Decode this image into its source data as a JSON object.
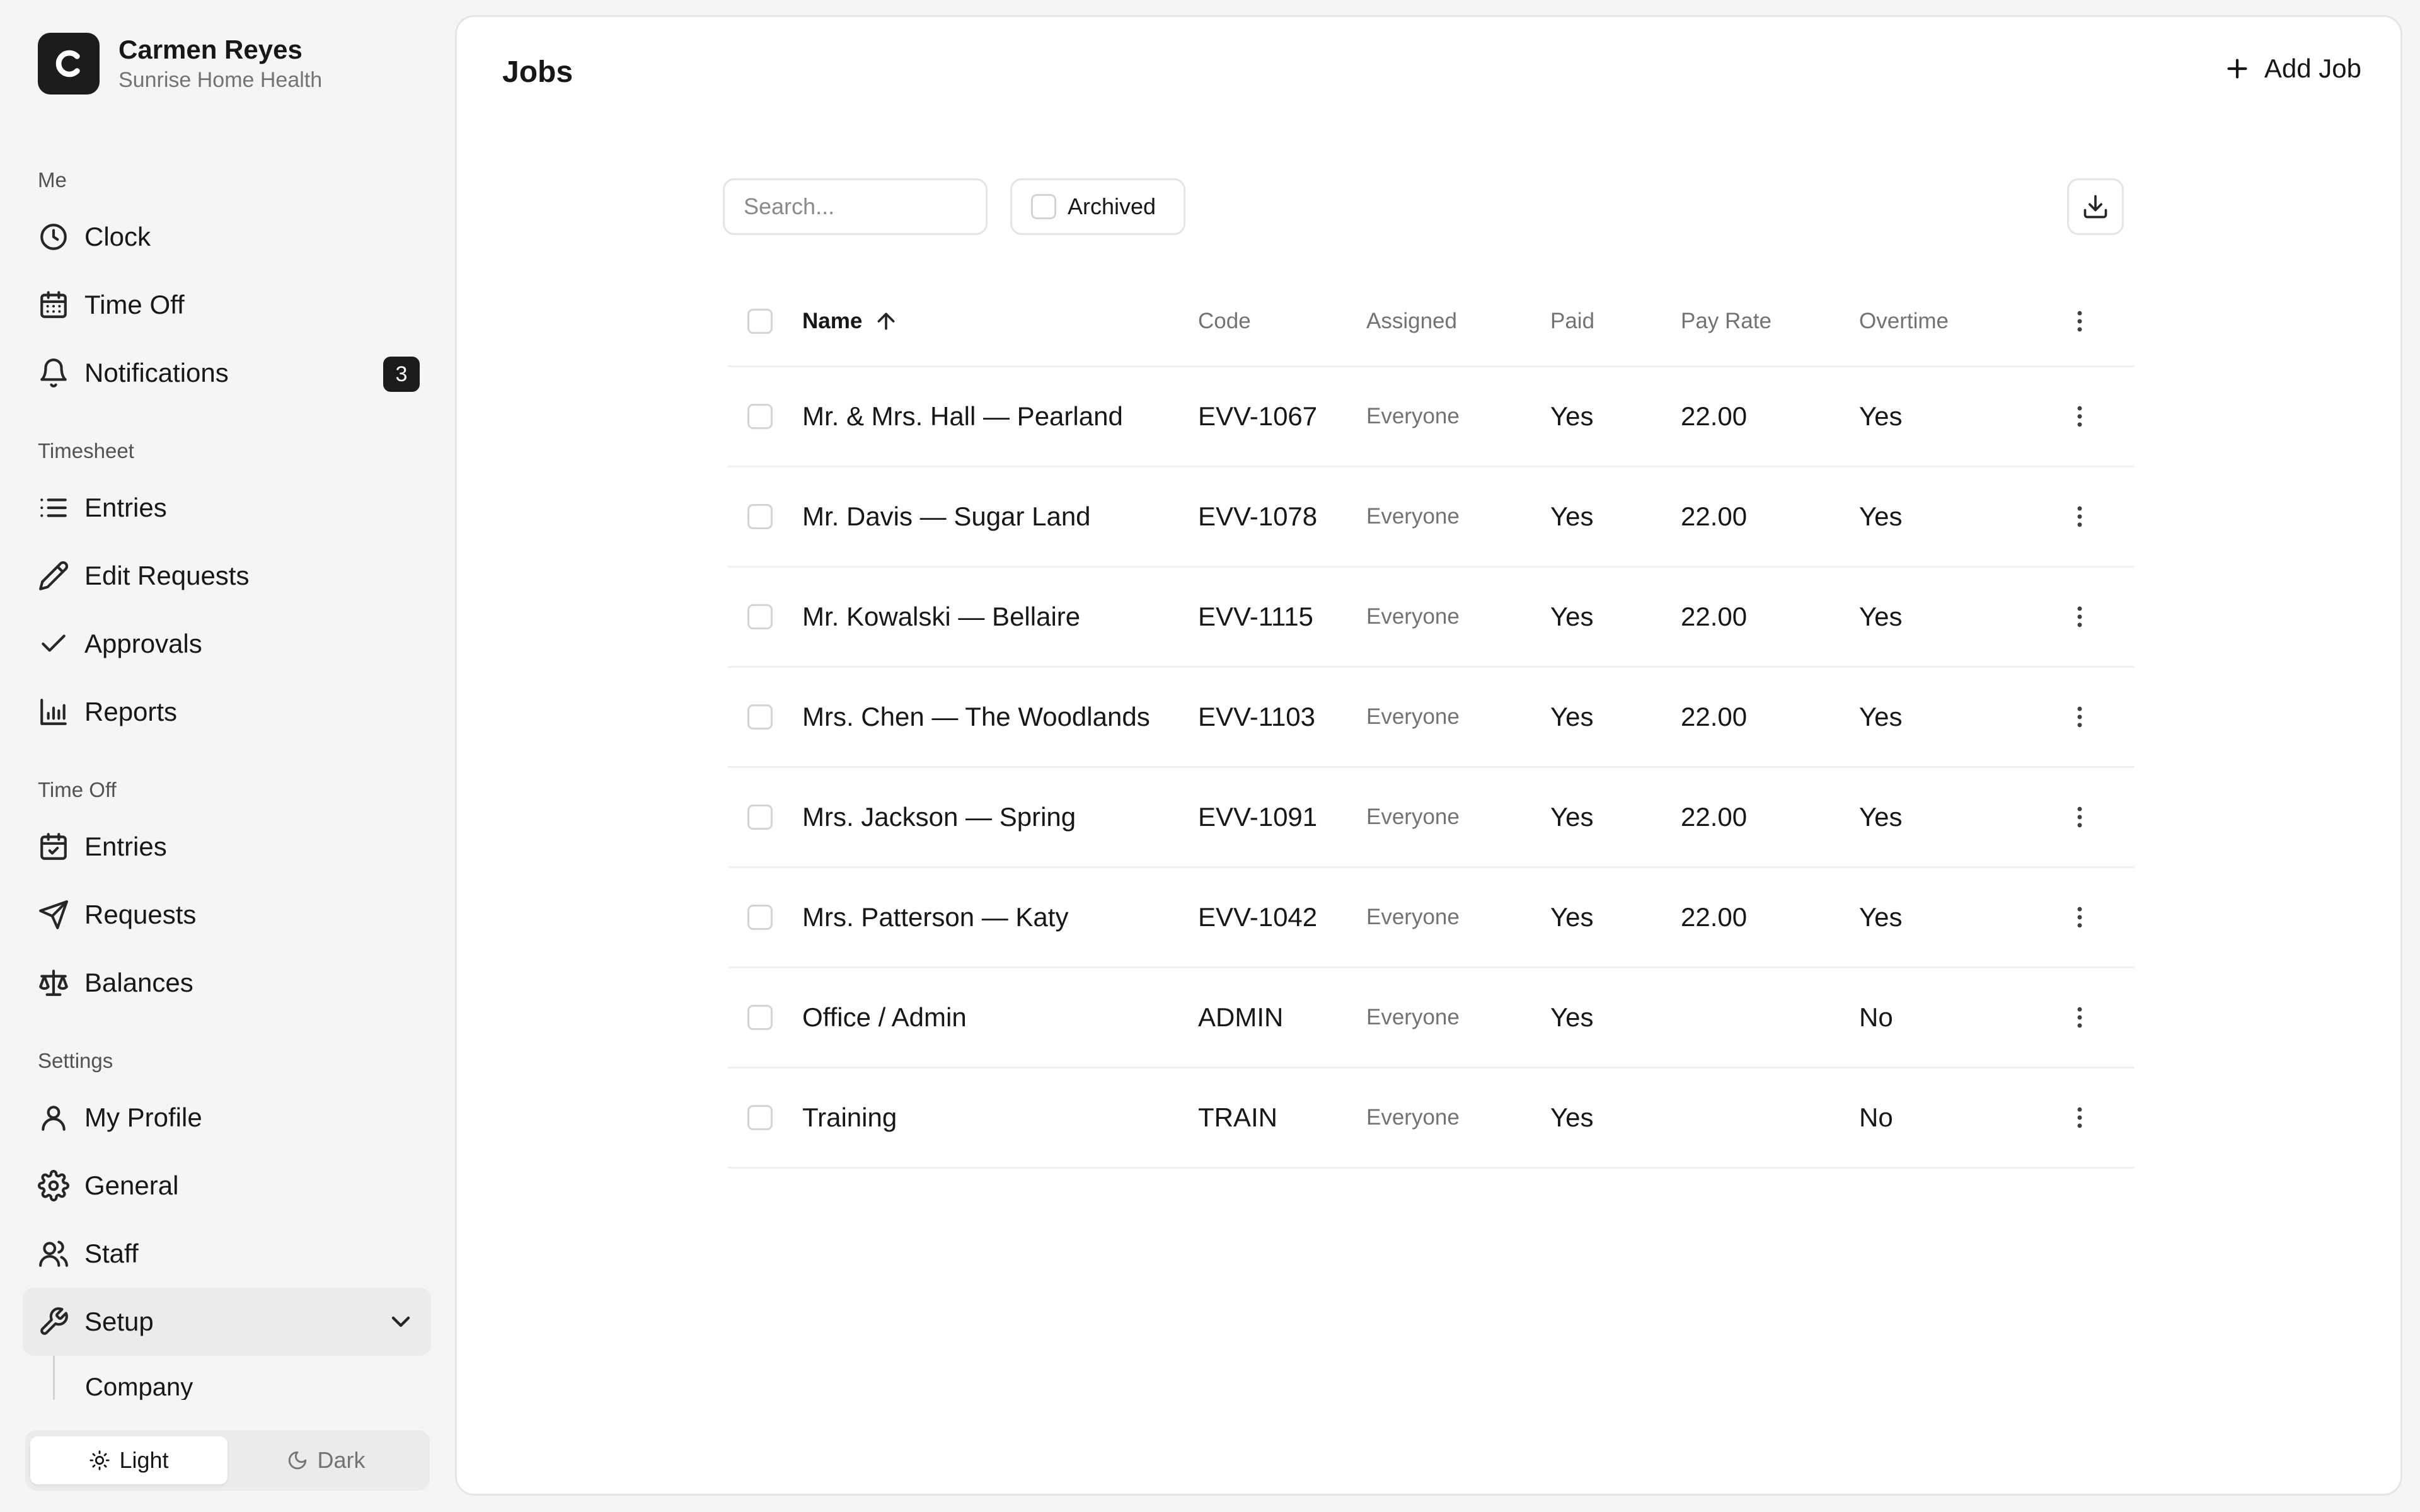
{
  "brand": {
    "initial": "C",
    "name": "Carmen Reyes",
    "org": "Sunrise Home Health"
  },
  "nav": {
    "me_label": "Me",
    "clock": "Clock",
    "time_off": "Time Off",
    "notifications": "Notifications",
    "notifications_count": "3",
    "timesheet_label": "Timesheet",
    "ts_entries": "Entries",
    "edit_requests": "Edit Requests",
    "approvals": "Approvals",
    "reports": "Reports",
    "timeoff_label": "Time Off",
    "to_entries": "Entries",
    "requests": "Requests",
    "balances": "Balances",
    "settings_label": "Settings",
    "my_profile": "My Profile",
    "general": "General",
    "staff": "Staff",
    "setup": "Setup",
    "company": "Company"
  },
  "theme": {
    "light": "Light",
    "dark": "Dark",
    "selected": "Light"
  },
  "header": {
    "title": "Jobs",
    "add_job": "Add Job"
  },
  "toolbar": {
    "search_placeholder": "Search...",
    "search_value": "",
    "archived_label": "Archived",
    "archived_checked": false
  },
  "table": {
    "columns": {
      "name": "Name",
      "code": "Code",
      "assigned": "Assigned",
      "paid": "Paid",
      "pay_rate": "Pay Rate",
      "overtime": "Overtime"
    },
    "sort": {
      "column": "name",
      "direction": "asc"
    },
    "rows": [
      {
        "name": "Mr. & Mrs. Hall — Pearland",
        "code": "EVV-1067",
        "assigned": "Everyone",
        "paid": "Yes",
        "pay_rate": "22.00",
        "overtime": "Yes"
      },
      {
        "name": "Mr. Davis — Sugar Land",
        "code": "EVV-1078",
        "assigned": "Everyone",
        "paid": "Yes",
        "pay_rate": "22.00",
        "overtime": "Yes"
      },
      {
        "name": "Mr. Kowalski — Bellaire",
        "code": "EVV-1115",
        "assigned": "Everyone",
        "paid": "Yes",
        "pay_rate": "22.00",
        "overtime": "Yes"
      },
      {
        "name": "Mrs. Chen — The Woodlands",
        "code": "EVV-1103",
        "assigned": "Everyone",
        "paid": "Yes",
        "pay_rate": "22.00",
        "overtime": "Yes"
      },
      {
        "name": "Mrs. Jackson — Spring",
        "code": "EVV-1091",
        "assigned": "Everyone",
        "paid": "Yes",
        "pay_rate": "22.00",
        "overtime": "Yes"
      },
      {
        "name": "Mrs. Patterson — Katy",
        "code": "EVV-1042",
        "assigned": "Everyone",
        "paid": "Yes",
        "pay_rate": "22.00",
        "overtime": "Yes"
      },
      {
        "name": "Office / Admin",
        "code": "ADMIN",
        "assigned": "Everyone",
        "paid": "Yes",
        "pay_rate": "",
        "overtime": "No"
      },
      {
        "name": "Training",
        "code": "TRAIN",
        "assigned": "Everyone",
        "paid": "Yes",
        "pay_rate": "",
        "overtime": "No"
      }
    ]
  }
}
